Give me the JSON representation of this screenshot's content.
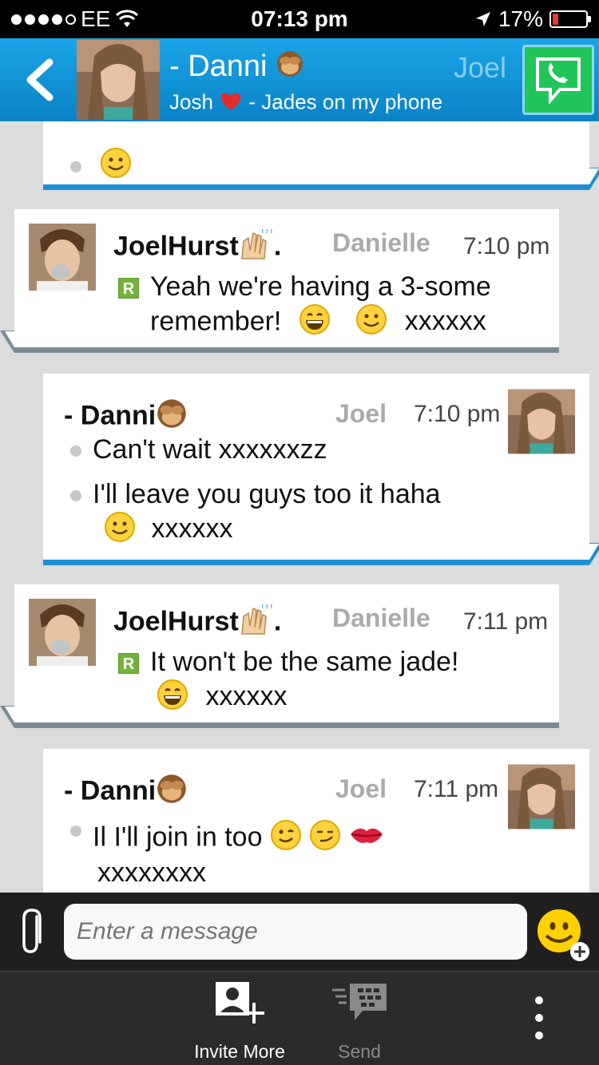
{
  "status_bar": {
    "carrier": "EE",
    "time": "07:13 pm",
    "battery": "17%",
    "battery_level": 0.17,
    "signal_icon": "signal-dots-icon",
    "wifi_icon": "wifi-icon",
    "location_icon": "location-arrow-icon"
  },
  "header": {
    "title": "- Danni",
    "subtitle": "Josh",
    "subtitle_rest": " - Jades on my phone",
    "faded_name": "Joel",
    "accent": "#1aa5e6"
  },
  "messages": [
    {
      "id": "m0",
      "side": "mine",
      "lines": [
        ""
      ]
    },
    {
      "id": "m1",
      "side": "theirs",
      "sender": "JoelHurst",
      "sender_suffix": ".",
      "faded": "Danielle",
      "time": "7:10 pm",
      "line1": "Yeah we're having a 3-some",
      "line2": "remember!",
      "line2_tail": "xxxxxx"
    },
    {
      "id": "m2",
      "side": "mine",
      "sender": "- Danni",
      "faded": "Joel",
      "time": "7:10 pm",
      "line1": "Can't wait xxxxxxzz",
      "line2": "I'll leave you guys too it haha",
      "line3_tail": "xxxxxx"
    },
    {
      "id": "m3",
      "side": "theirs",
      "sender": "JoelHurst",
      "sender_suffix": ".",
      "faded": "Danielle",
      "time": "7:11 pm",
      "line1": "It won't be the same jade!",
      "line2_tail": "xxxxxx"
    },
    {
      "id": "m4",
      "side": "mine",
      "sender": "- Danni",
      "faded": "Joel",
      "time": "7:11 pm",
      "line1": "Il I'll join in too",
      "line2": "xxxxxxxx"
    }
  ],
  "composer": {
    "placeholder": "Enter a message"
  },
  "toolbar": {
    "invite_label": "Invite More",
    "send_label": "Send"
  }
}
